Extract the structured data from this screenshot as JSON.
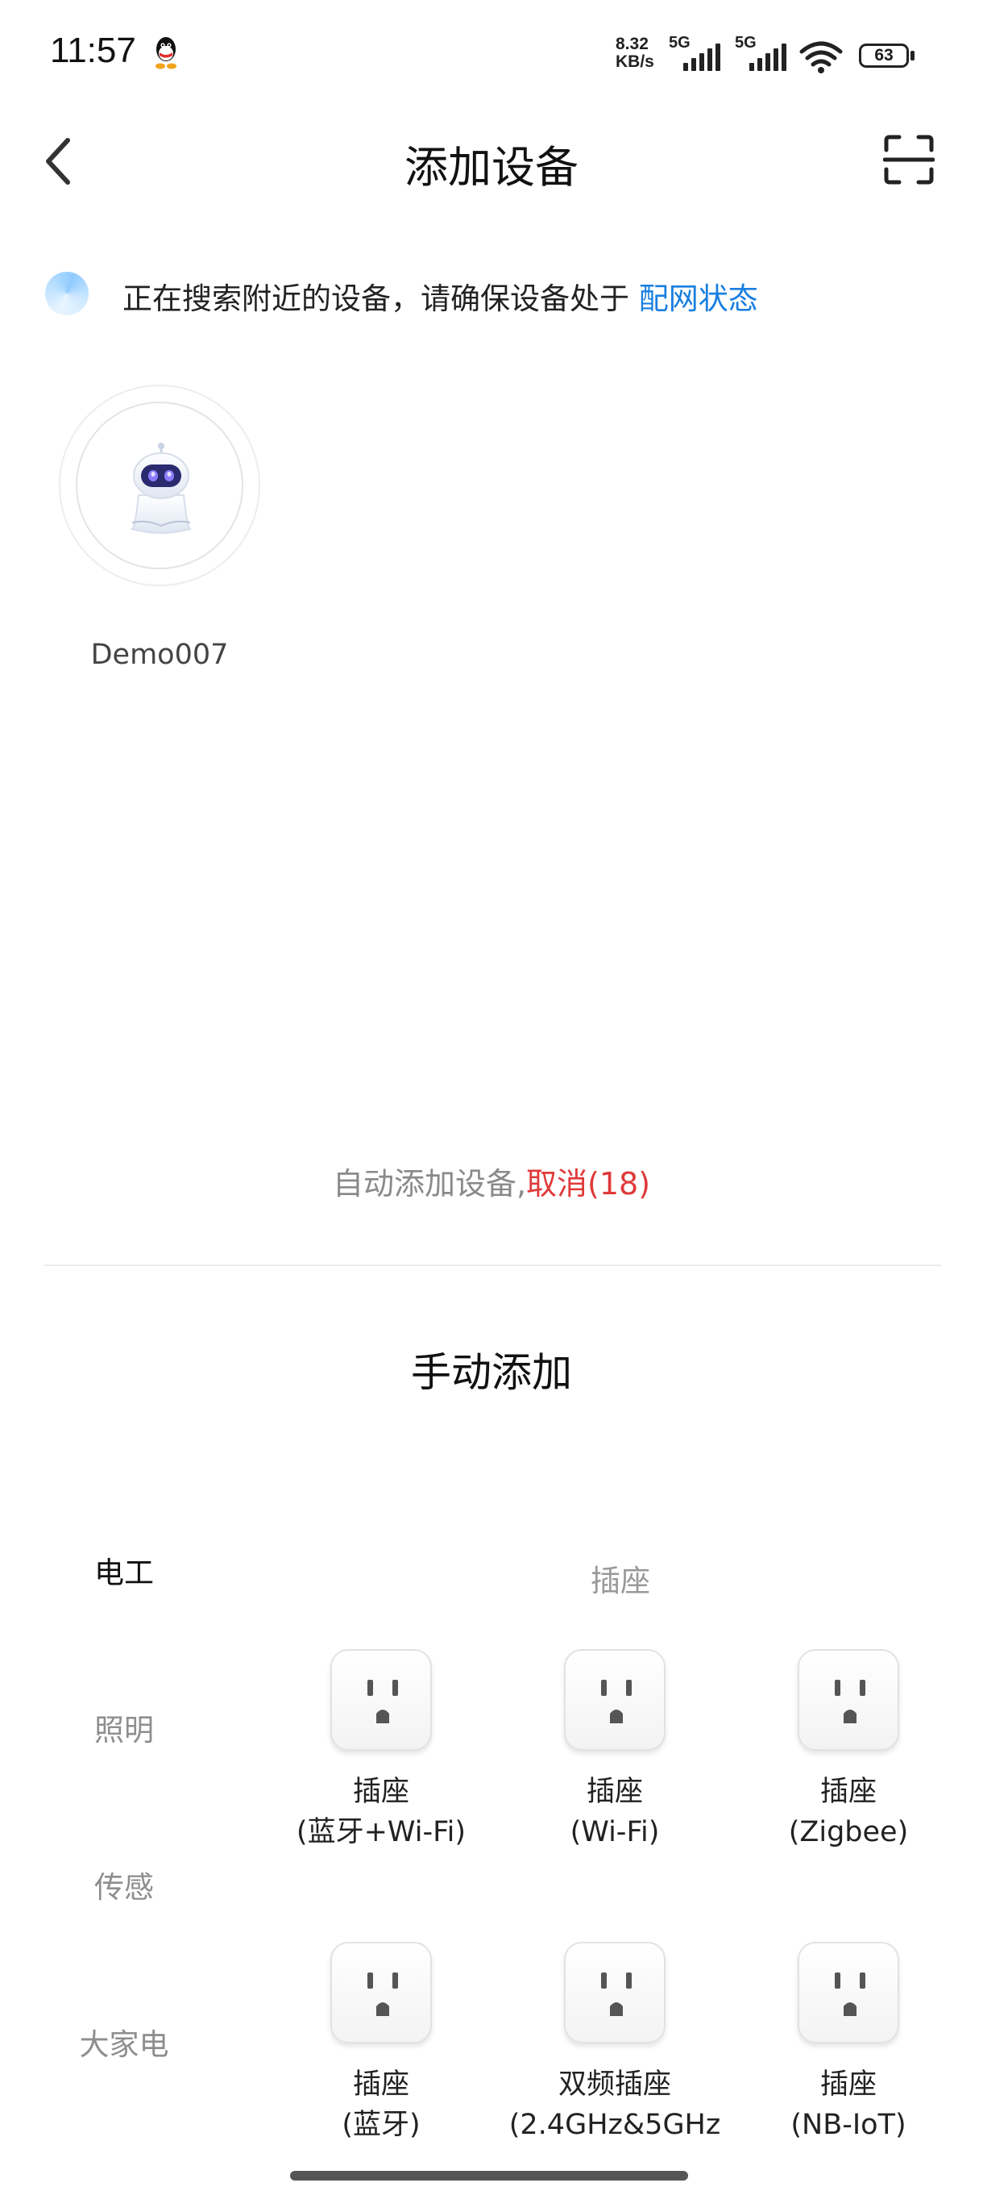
{
  "status_bar": {
    "time": "11:57",
    "net_speed_value": "8.32",
    "net_speed_unit": "KB/s",
    "sim1_label": "5G",
    "sim2_label": "5G",
    "battery": "63"
  },
  "header": {
    "title": "添加设备"
  },
  "searching": {
    "text": "正在搜索附近的设备，请确保设备处于 ",
    "link": "配网状态"
  },
  "discovered_devices": [
    {
      "name": "Demo007"
    }
  ],
  "auto_add": {
    "text": "自动添加设备,",
    "cancel": "取消(18)"
  },
  "manual": {
    "title": "手动添加",
    "categories": [
      {
        "label": "电工",
        "active": true
      },
      {
        "label": "照明",
        "active": false
      },
      {
        "label": "传感",
        "active": false
      },
      {
        "label": "大家电",
        "active": false
      }
    ],
    "section_label": "插座",
    "products": [
      {
        "line1": "插座",
        "line2": "(蓝牙+Wi-Fi)"
      },
      {
        "line1": "插座",
        "line2": "(Wi-Fi)"
      },
      {
        "line1": "插座",
        "line2": "(Zigbee)"
      },
      {
        "line1": "插座",
        "line2": "(蓝牙)"
      },
      {
        "line1": "双频插座",
        "line2": "(2.4GHz&5GHz"
      },
      {
        "line1": "插座",
        "line2": "(NB-IoT)"
      }
    ]
  },
  "colors": {
    "link_blue": "#1a7fe0",
    "cancel_red": "#e03a3a"
  },
  "icons": [
    "qq-icon",
    "signal-icon",
    "wifi-icon",
    "battery-icon",
    "back-icon",
    "scan-icon",
    "search-orb-icon",
    "robot-icon",
    "socket-icon"
  ]
}
